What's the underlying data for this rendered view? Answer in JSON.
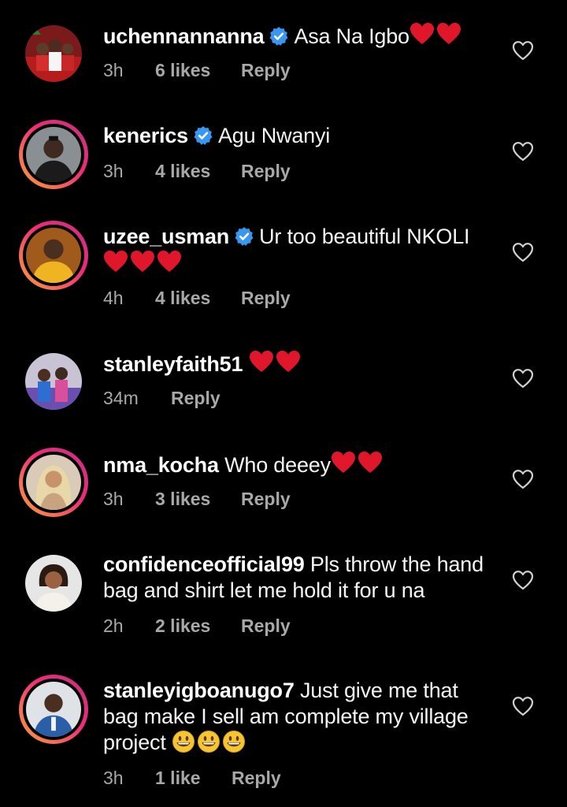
{
  "colors": {
    "background": "#000000",
    "verified": "#3897f0",
    "heart": "#e0162b",
    "meta": "#a8a8a8"
  },
  "comments": [
    {
      "username": "uchennannanna",
      "verified": true,
      "text": "Asa Na Igbo",
      "hearts": 2,
      "time": "3h",
      "likes": "6 likes",
      "reply": "Reply",
      "story_ring": false
    },
    {
      "username": "kenerics",
      "verified": true,
      "text": "Agu Nwanyi",
      "hearts": 0,
      "time": "3h",
      "likes": "4 likes",
      "reply": "Reply",
      "story_ring": true
    },
    {
      "username": "uzee_usman",
      "verified": true,
      "text": "Ur too beautiful NKOLI",
      "hearts": 3,
      "time": "4h",
      "likes": "4 likes",
      "reply": "Reply",
      "story_ring": true
    },
    {
      "username": "stanleyfaith51",
      "verified": false,
      "text": "",
      "hearts": 2,
      "time": "34m",
      "likes": "",
      "reply": "Reply",
      "story_ring": false
    },
    {
      "username": "nma_kocha",
      "verified": false,
      "text": "Who deeey",
      "hearts": 2,
      "time": "3h",
      "likes": "3 likes",
      "reply": "Reply",
      "story_ring": true
    },
    {
      "username": "confidenceofficial99",
      "verified": false,
      "text": "Pls throw the hand bag and shirt let me hold it for u na",
      "hearts": 0,
      "time": "2h",
      "likes": "2 likes",
      "reply": "Reply",
      "story_ring": false
    },
    {
      "username": "stanleyigboanugo7",
      "verified": false,
      "text": "Just give me that bag make I sell am complete my village project",
      "emoji": 3,
      "time": "3h",
      "likes": "1 like",
      "reply": "Reply",
      "story_ring": true
    }
  ],
  "icons": {
    "like": "heart-outline-icon",
    "verified": "verified-badge-icon",
    "emoji": "grinning-face-icon"
  }
}
